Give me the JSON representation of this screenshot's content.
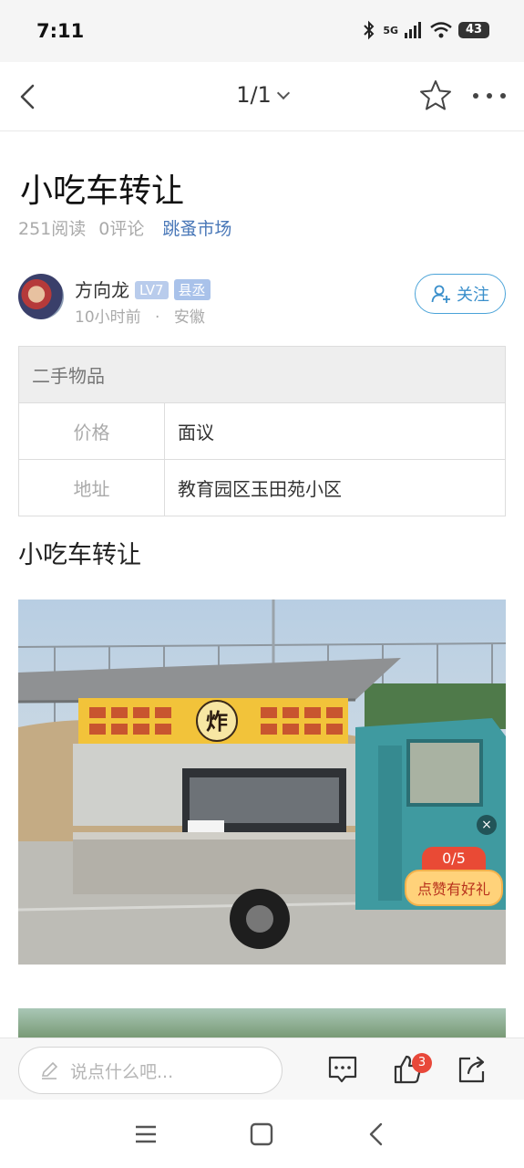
{
  "status_bar": {
    "time": "7:11",
    "network": "5G",
    "battery": "43"
  },
  "nav": {
    "page_indicator": "1/1"
  },
  "post": {
    "title": "小吃车转让",
    "reads": "251阅读",
    "comments": "0评论",
    "category": "跳蚤市场",
    "subtitle": "小吃车转让"
  },
  "author": {
    "name": "方向龙",
    "level": "LV7",
    "rank_title": "县丞",
    "time_ago": "10小时前",
    "separator": "·",
    "location": "安徽",
    "follow_label": "关注"
  },
  "info_table": {
    "header": "二手物品",
    "rows": [
      {
        "key": "价格",
        "value": "面议"
      },
      {
        "key": "地址",
        "value": "教育园区玉田苑小区"
      }
    ]
  },
  "photo": {
    "sign_text": "炸"
  },
  "reward": {
    "count": "0/5",
    "label": "点赞有好礼",
    "close": "×"
  },
  "bottom_bar": {
    "comment_placeholder": "说点什么吧...",
    "like_count": "3"
  },
  "colors": {
    "accent_blue": "#3a8fcb",
    "tag_blue": "#4a78b8",
    "badge_red": "#e8483a"
  }
}
